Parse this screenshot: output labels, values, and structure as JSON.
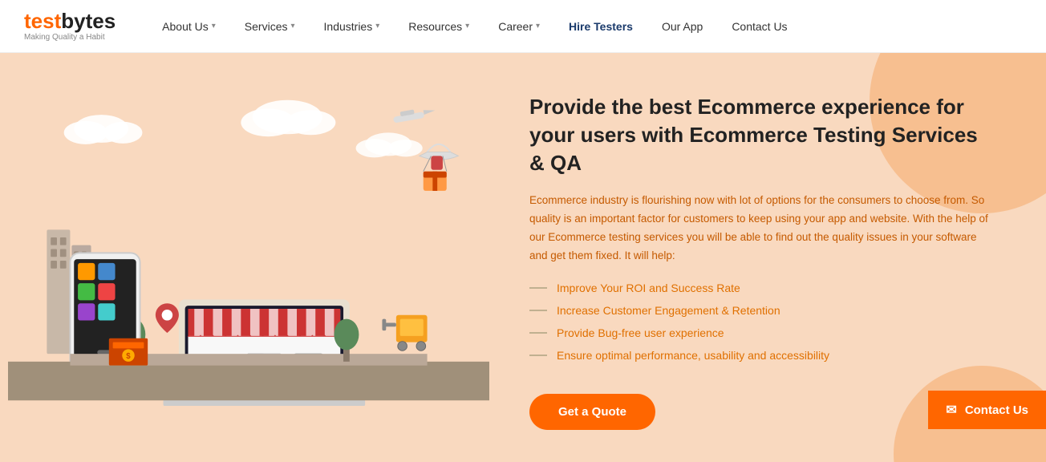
{
  "logo": {
    "test": "test",
    "bytes": "bytes",
    "tagline": "Making Quality a Habit"
  },
  "nav": {
    "items": [
      {
        "label": "About Us",
        "hasDropdown": true,
        "id": "about-us"
      },
      {
        "label": "Services",
        "hasDropdown": true,
        "id": "services"
      },
      {
        "label": "Industries",
        "hasDropdown": true,
        "id": "industries"
      },
      {
        "label": "Resources",
        "hasDropdown": true,
        "id": "resources"
      },
      {
        "label": "Career",
        "hasDropdown": true,
        "id": "career"
      },
      {
        "label": "Hire Testers",
        "hasDropdown": false,
        "id": "hire-testers",
        "highlight": true
      },
      {
        "label": "Our App",
        "hasDropdown": false,
        "id": "our-app"
      },
      {
        "label": "Contact Us",
        "hasDropdown": false,
        "id": "contact-us"
      }
    ]
  },
  "hero": {
    "title": "Provide the best Ecommerce experience for your users with Ecommerce Testing Services & QA",
    "description": "Ecommerce industry is flourishing now with lot of options for the consumers to choose from. So quality is an important factor for customers to keep using your app and website. With the help of our Ecommerce testing services you will be able to find out the quality issues in your software and get them fixed. It will help:",
    "bullets": [
      "Improve Your ROI and Success Rate",
      "Increase Customer Engagement & Retention",
      "Provide Bug-free user experience",
      "Ensure optimal performance, usability and accessibility"
    ],
    "cta_label": "Get a Quote"
  },
  "contact_sticky": {
    "label": "Contact Us"
  }
}
